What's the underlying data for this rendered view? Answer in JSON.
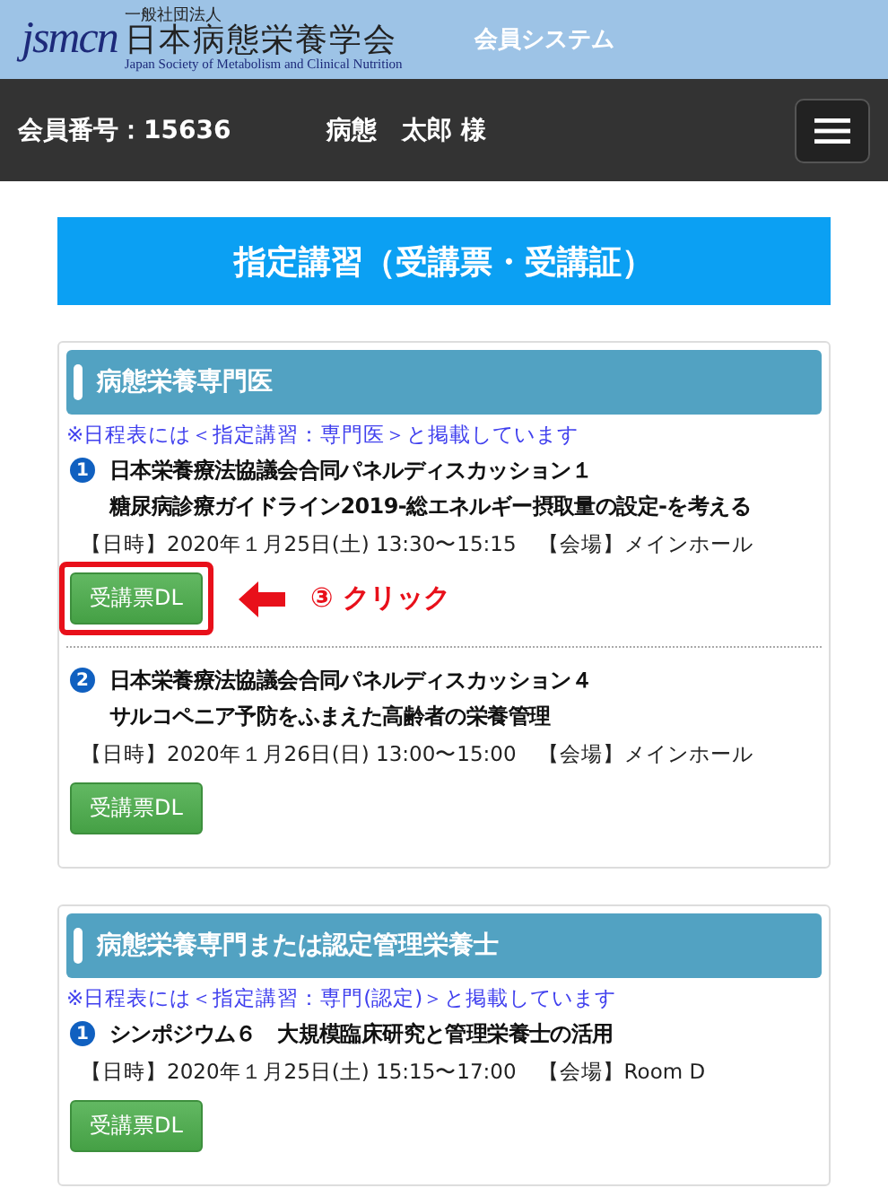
{
  "header": {
    "logo_mark": "jsmcn",
    "logo_org_type": "一般社団法人",
    "logo_name": "日本病態栄養学会",
    "logo_english": "Japan Society of Metabolism and Clinical Nutrition",
    "system_title": "会員システム"
  },
  "user_bar": {
    "member_number": "会員番号：15636",
    "user_name": "病態　太郎 様"
  },
  "banner": {
    "title": "指定講習（受講票・受講証）"
  },
  "sections": [
    {
      "title": "病態栄養専門医",
      "note": "※日程表には＜指定講習：専門医＞と掲載しています",
      "items": [
        {
          "number": "1",
          "title_lines": [
            "日本栄養療法協議会合同パネルディスカッション１",
            "糖尿病診療ガイドライン2019-総エネルギー摂取量の設定-を考える"
          ],
          "schedule": "【日時】2020年１月25日(土) 13:30〜15:15　【会場】メインホール",
          "button": "受講票DL",
          "annotation": "③ クリック"
        },
        {
          "number": "2",
          "title_lines": [
            "日本栄養療法協議会合同パネルディスカッション４",
            "サルコペニア予防をふまえた高齢者の栄養管理"
          ],
          "schedule": "【日時】2020年１月26日(日) 13:00〜15:00　【会場】メインホール",
          "button": "受講票DL"
        }
      ]
    },
    {
      "title": "病態栄養専門または認定管理栄養士",
      "note": "※日程表には＜指定講習：専門(認定)＞と掲載しています",
      "items": [
        {
          "number": "1",
          "title_lines": [
            "シンポジウム６　大規模臨床研究と管理栄養士の活用"
          ],
          "schedule": "【日時】2020年１月25日(土) 15:15〜17:00　【会場】Room D",
          "button": "受講票DL"
        }
      ]
    }
  ]
}
